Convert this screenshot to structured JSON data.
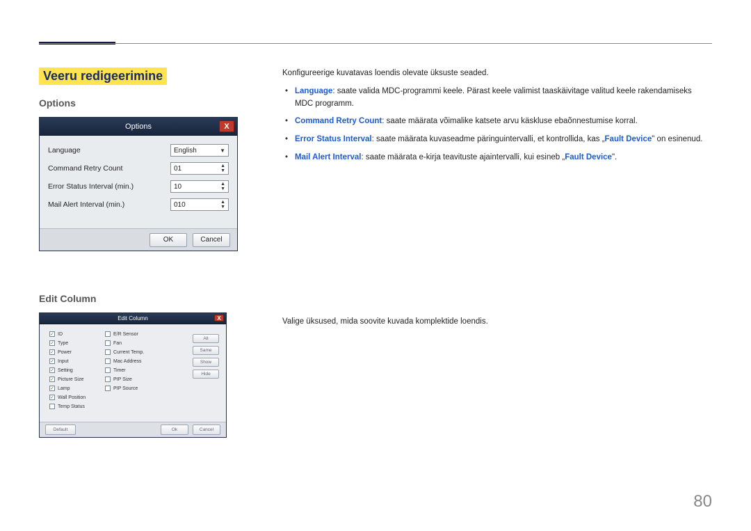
{
  "page_number": "80",
  "heading": "Veeru redigeerimine",
  "sub1": "Options",
  "sub2": "Edit Column",
  "intro_options": "Konfigureerige kuvatavas loendis olevate üksuste seaded.",
  "bullets": {
    "b1_term": "Language",
    "b1_text": ": saate valida MDC-programmi keele. Pärast keele valimist taaskäivitage valitud keele rakendamiseks MDC programm.",
    "b2_term": "Command Retry Count",
    "b2_text": ": saate määrata võimalike katsete arvu käskluse ebaõnnestumise korral.",
    "b3_term": "Error Status Interval",
    "b3_text_a": ": saate määrata kuvaseadme päringuintervalli, et kontrollida, kas „",
    "b3_fault": "Fault Device",
    "b3_text_b": "\" on esinenud.",
    "b4_term": "Mail Alert Interval",
    "b4_text_a": ": saate määrata e-kirja teavituste ajaintervalli, kui esineb „",
    "b4_fault": "Fault Device",
    "b4_text_b": "\"."
  },
  "intro_editcolumn": "Valige üksused, mida soovite kuvada komplektide loendis.",
  "options_dialog": {
    "title": "Options",
    "rows": {
      "language_label": "Language",
      "language_value": "English",
      "retry_label": "Command Retry Count",
      "retry_value": "01",
      "errint_label": "Error Status Interval (min.)",
      "errint_value": "10",
      "mailint_label": "Mail Alert Interval (min.)",
      "mailint_value": "010"
    },
    "ok": "OK",
    "cancel": "Cancel"
  },
  "edit_dialog": {
    "title": "Edit Column",
    "col1": {
      "i0": "ID",
      "i1": "Type",
      "i2": "Power",
      "i3": "Input",
      "i4": "Setting",
      "i5": "Picture Size",
      "i6": "Lamp",
      "i7": "Wall Position",
      "i8": "Temp Status"
    },
    "col2": {
      "i0": "E/R Sensor",
      "i1": "Fan",
      "i2": "Current Temp.",
      "i3": "Mac Address",
      "i4": "Timer",
      "i5": "PIP Size",
      "i6": "PIP Source"
    },
    "side": {
      "all": "All",
      "same": "Same",
      "show": "Show",
      "hide": "Hide"
    },
    "default": "Default",
    "ok": "Ok",
    "cancel": "Cancel"
  }
}
